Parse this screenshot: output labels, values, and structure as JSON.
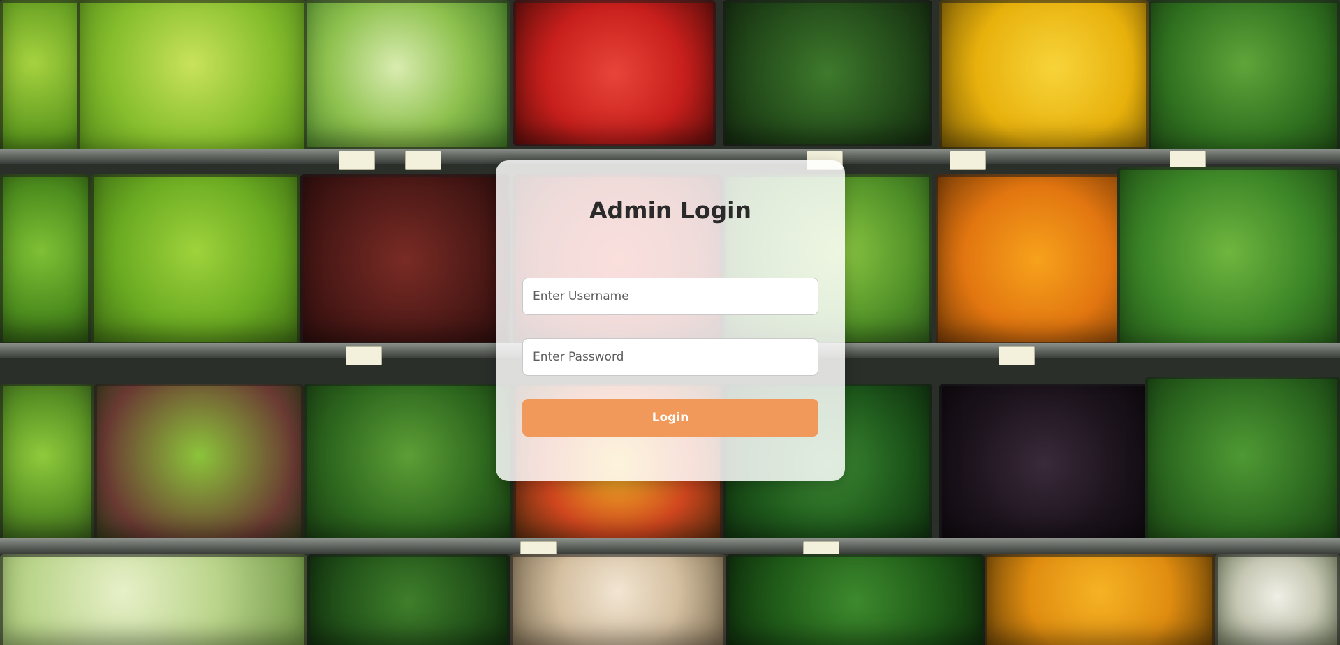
{
  "login": {
    "title": "Admin Login",
    "username_placeholder": "Enter Username",
    "password_placeholder": "Enter Password",
    "button_label": "Login"
  },
  "colors": {
    "accent": "#f0995a",
    "card": "#ffffff"
  }
}
